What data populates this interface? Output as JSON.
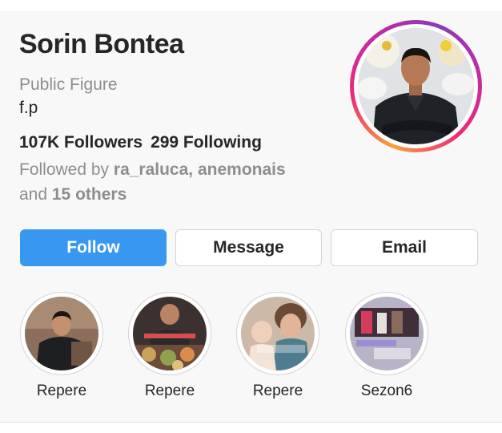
{
  "profile": {
    "name": "Sorin Bontea",
    "category": "Public Figure",
    "bio": "f.p",
    "followers": "107K Followers",
    "following": "299 Following",
    "followed_by_prefix": "Followed by ",
    "followed_by_users": "ra_raluca, anemonais",
    "followed_by_and": "and ",
    "followed_by_others": "15 others"
  },
  "actions": {
    "follow": "Follow",
    "message": "Message",
    "email": "Email"
  },
  "highlights": [
    {
      "label": "Repere",
      "icon": "highlight-chef-portrait"
    },
    {
      "label": "Repere",
      "icon": "highlight-food-table"
    },
    {
      "label": "Repere",
      "icon": "highlight-family-photo"
    },
    {
      "label": "Sezon6",
      "icon": "highlight-tv-show"
    }
  ],
  "colors": {
    "accent": "#3897f0",
    "text": "#262626",
    "secondary": "#8e8e8e"
  }
}
